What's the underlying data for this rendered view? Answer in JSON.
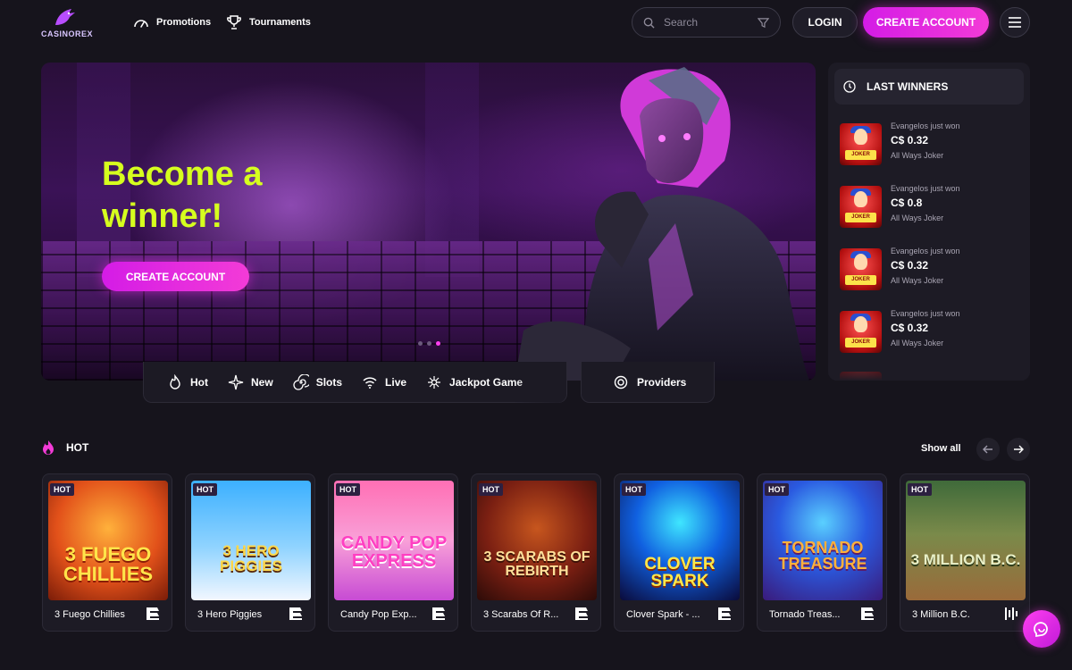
{
  "brand": {
    "name": "CASINOREX",
    "accent": "#f33bd7",
    "headline_color": "#d6ff1e"
  },
  "nav": {
    "promotions": "Promotions",
    "tournaments": "Tournaments"
  },
  "search": {
    "placeholder": "Search"
  },
  "header_buttons": {
    "login": "LOGIN",
    "create_account": "CREATE ACCOUNT"
  },
  "hero": {
    "title": "Become a winner!",
    "cta": "CREATE ACCOUNT",
    "slides": 3,
    "active_slide": 3
  },
  "categories": [
    {
      "label": "Hot",
      "icon": "fire-icon"
    },
    {
      "label": "New",
      "icon": "sparkle-icon"
    },
    {
      "label": "Slots",
      "icon": "spiral-icon"
    },
    {
      "label": "Live",
      "icon": "wifi-icon"
    },
    {
      "label": "Jackpot Game",
      "icon": "star-burst-icon"
    }
  ],
  "providers": {
    "label": "Providers"
  },
  "last_winners": {
    "title": "LAST WINNERS",
    "items": [
      {
        "who": "Evangelos just won",
        "amount": "C$ 0.32",
        "game": "All Ways Joker"
      },
      {
        "who": "Evangelos just won",
        "amount": "C$ 0.8",
        "game": "All Ways Joker"
      },
      {
        "who": "Evangelos just won",
        "amount": "C$ 0.32",
        "game": "All Ways Joker"
      },
      {
        "who": "Evangelos just won",
        "amount": "C$ 0.32",
        "game": "All Ways Joker"
      }
    ]
  },
  "hot_section": {
    "title": "HOT",
    "show_all": "Show all",
    "badge": "HOT",
    "games": [
      {
        "name": "3 Fuego Chillies",
        "art": "3 FUEGO CHILLIES"
      },
      {
        "name": "3 Hero Piggies",
        "art": "3 HERO PIGGIES"
      },
      {
        "name": "Candy Pop Exp...",
        "art": "CANDY POP EXPRESS"
      },
      {
        "name": "3 Scarabs Of R...",
        "art": "3 SCARABS OF REBIRTH"
      },
      {
        "name": "Clover Spark - ...",
        "art": "CLOVER SPARK"
      },
      {
        "name": "Tornado Treas...",
        "art": "TORNADO TREASURE"
      },
      {
        "name": "3 Million B.C.",
        "art": "3 MILLION B.C."
      }
    ]
  }
}
